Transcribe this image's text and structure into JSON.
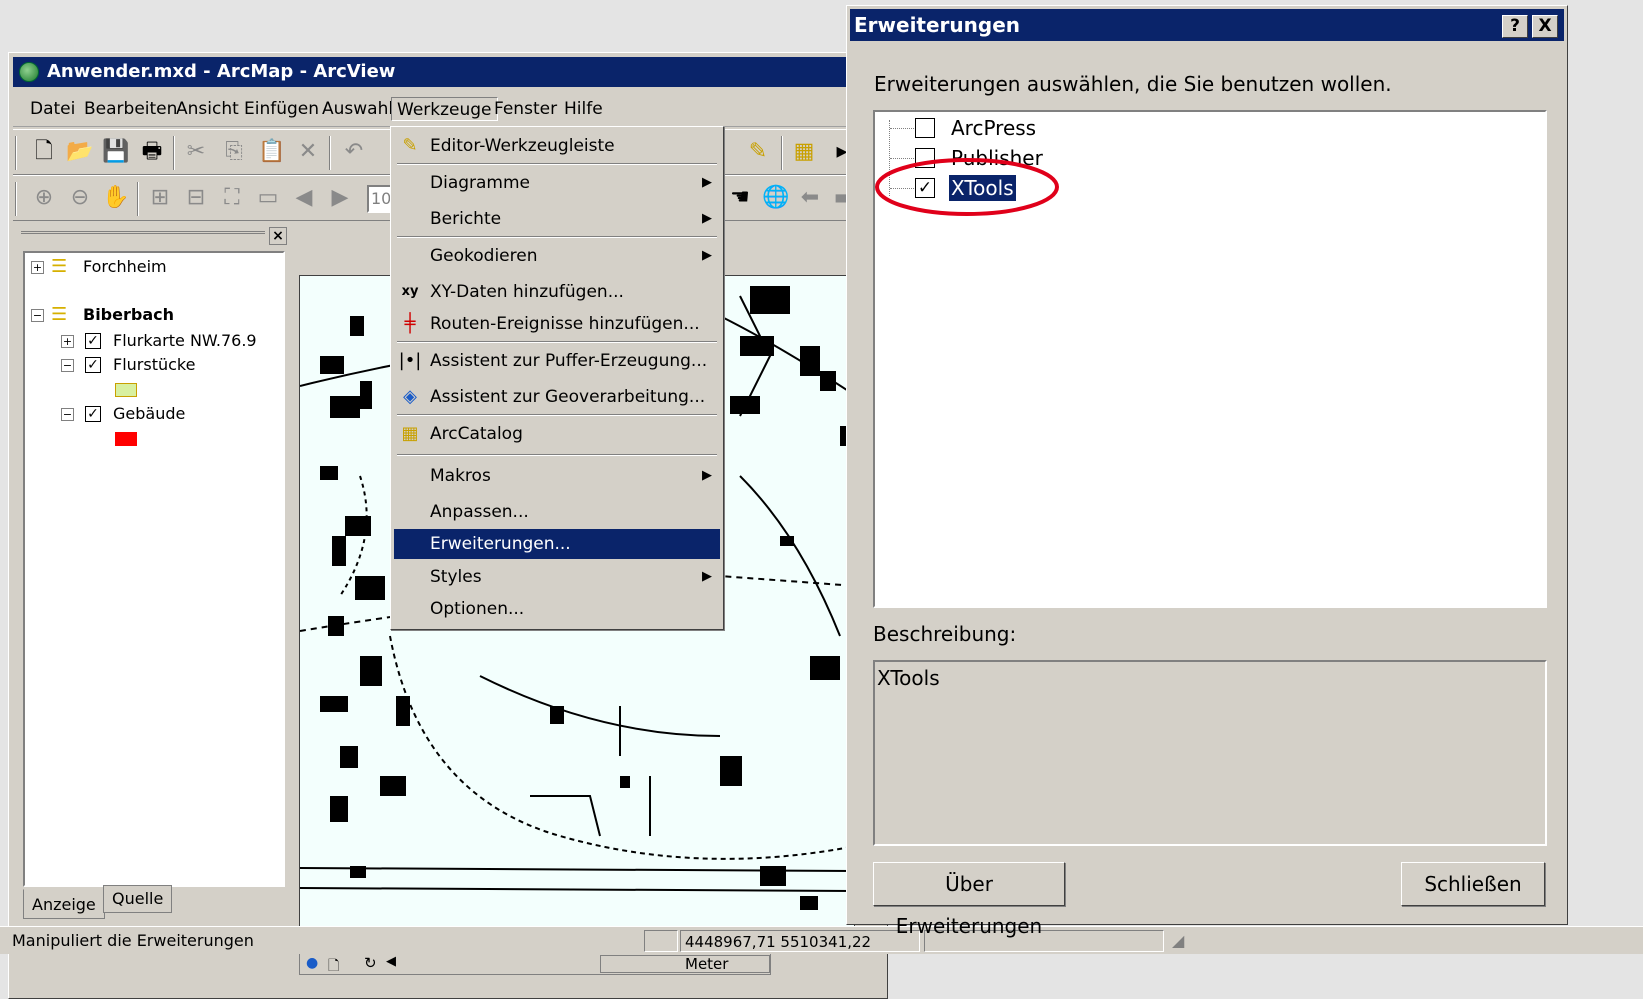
{
  "arcmap": {
    "title": "Anwender.mxd - ArcMap - ArcView",
    "menus": [
      "Datei",
      "Bearbeiten",
      "Ansicht",
      "Einfügen",
      "Auswahl",
      "Werkzeuge",
      "Fenster",
      "Hilfe"
    ],
    "toolbar_scale": "10",
    "toc": {
      "layers": [
        {
          "label": "Forchheim",
          "expanded": false
        },
        {
          "label": "Biberbach",
          "expanded": true
        }
      ],
      "sublayers": [
        "Flurkarte NW.76.9",
        "Flurstücke",
        "Gebäude"
      ],
      "colors": {
        "flurstuecke": "#d8f0a0",
        "gebaeude": "#ff0000"
      },
      "tabs": [
        "Anzeige",
        "Quelle"
      ]
    }
  },
  "werkzeuge_menu": {
    "items": [
      {
        "label": "Editor-Werkzeugleiste",
        "icon": "editor-pencil-icon"
      },
      {
        "label": "Diagramme",
        "submenu": true
      },
      {
        "label": "Berichte",
        "submenu": true
      },
      {
        "label": "Geokodieren",
        "submenu": true
      },
      {
        "label": "XY-Daten hinzufügen...",
        "icon": "xy-icon"
      },
      {
        "label": "Routen-Ereignisse hinzufügen...",
        "icon": "route-icon"
      },
      {
        "label": "Assistent zur Puffer-Erzeugung...",
        "icon": "buffer-icon"
      },
      {
        "label": "Assistent zur Geoverarbeitung...",
        "icon": "geoprocessing-icon"
      },
      {
        "label": "ArcCatalog",
        "icon": "arccatalog-icon"
      },
      {
        "label": "Makros",
        "submenu": true
      },
      {
        "label": "Anpassen..."
      },
      {
        "label": "Erweiterungen...",
        "selected": true
      },
      {
        "label": "Styles",
        "submenu": true
      },
      {
        "label": "Optionen..."
      }
    ]
  },
  "status": {
    "message": "Manipuliert die Erweiterungen",
    "coordinates": "4448967,71  5510341,22 Meter"
  },
  "dialog": {
    "title": "Erweiterungen",
    "help_button": "?",
    "close_button": "X",
    "prompt": "Erweiterungen auswählen, die Sie benutzen wollen.",
    "extensions": [
      {
        "label": "ArcPress",
        "checked": false
      },
      {
        "label": "Publisher",
        "checked": false
      },
      {
        "label": "XTools",
        "checked": true,
        "selected": true
      }
    ],
    "description_label": "Beschreibung:",
    "description_text": "XTools",
    "about_button": "Über Erweiterungen",
    "close_label": "Schließen",
    "highlight_color": "#e0001a"
  }
}
